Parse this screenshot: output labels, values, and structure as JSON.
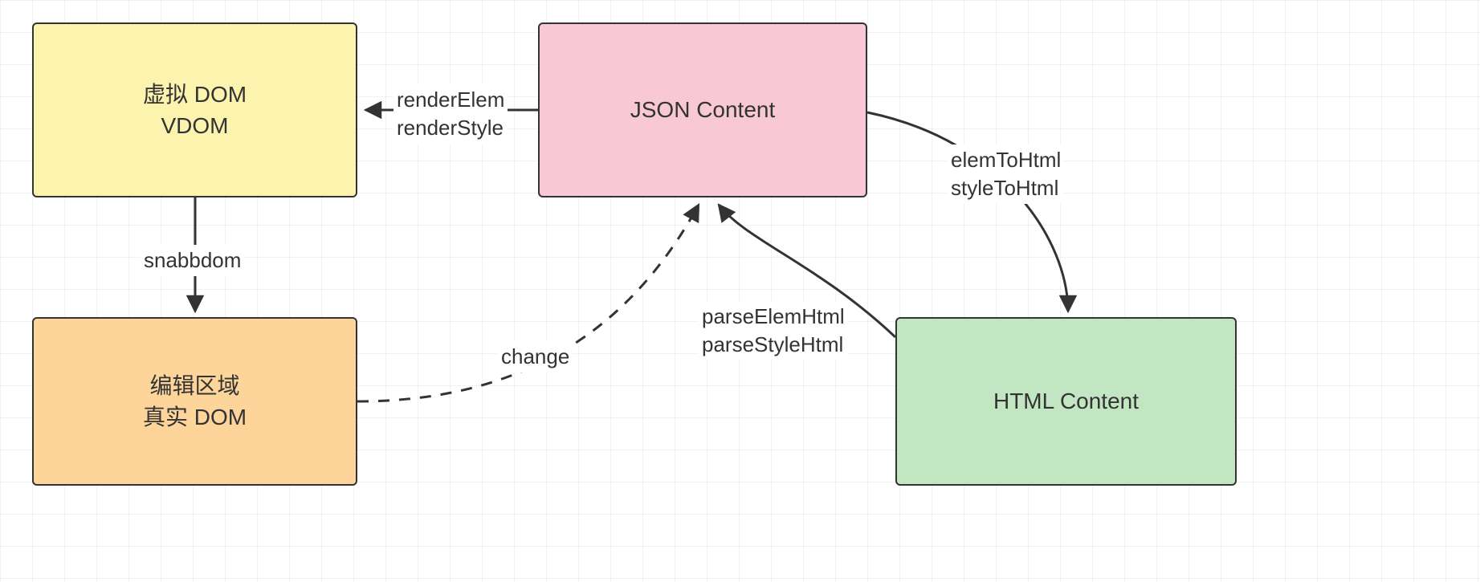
{
  "nodes": {
    "vdom": {
      "line1": "虚拟 DOM",
      "line2": "VDOM"
    },
    "json": {
      "line1": "JSON Content"
    },
    "real": {
      "line1": "编辑区域",
      "line2": "真实 DOM"
    },
    "html": {
      "line1": "HTML Content"
    }
  },
  "edges": {
    "json_to_vdom": {
      "line1": "renderElem",
      "line2": "renderStyle"
    },
    "vdom_to_real": {
      "line1": "snabbdom"
    },
    "real_to_json": {
      "line1": "change"
    },
    "html_to_json": {
      "line1": "parseElemHtml",
      "line2": "parseStyleHtml"
    },
    "json_to_html": {
      "line1": "elemToHtml",
      "line2": "styleToHtml"
    }
  },
  "colors": {
    "vdom": "#FBF3AE",
    "json": "#F8C9D4",
    "real": "#FDD59B",
    "html": "#C2E6C2",
    "stroke": "#333333"
  }
}
